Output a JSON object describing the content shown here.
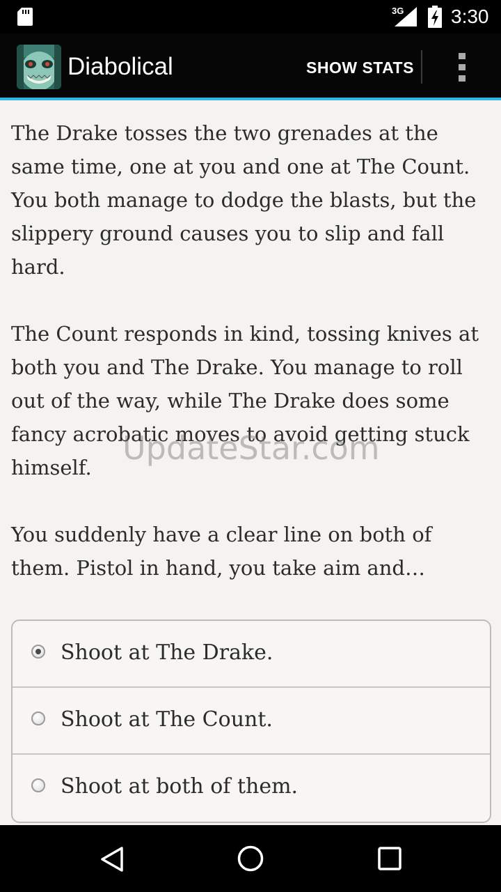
{
  "status_bar": {
    "network": "3G",
    "time": "3:30"
  },
  "action_bar": {
    "title": "Diabolical",
    "show_stats_label": "SHOW STATS"
  },
  "story": {
    "paragraphs": [
      "The Drake tosses the two grenades at the same time, one at you and one at The Count. You both manage to dodge the blasts, but the slippery ground causes you to slip and fall hard.",
      "The Count responds in kind, tossing knives at both you and The Drake. You manage to roll out of the way, while The Drake does some fancy acrobatic moves to avoid getting stuck himself.",
      "You suddenly have a clear line on both of them. Pistol in hand, you take aim and…"
    ]
  },
  "choices": [
    {
      "label": "Shoot at The Drake.",
      "selected": true
    },
    {
      "label": "Shoot at The Count.",
      "selected": false
    },
    {
      "label": "Shoot at both of them.",
      "selected": false
    }
  ],
  "watermark": "UpdateStar.com",
  "icons": {
    "sd_card": "sd-card-icon",
    "signal": "signal-icon",
    "battery": "battery-charging-icon",
    "overflow": "overflow-menu-icon",
    "nav_back": "back-icon",
    "nav_home": "home-icon",
    "nav_recents": "recents-icon"
  },
  "colors": {
    "accent": "#33b5e5",
    "background": "#f5f3ef",
    "text": "#2b2b2b"
  }
}
